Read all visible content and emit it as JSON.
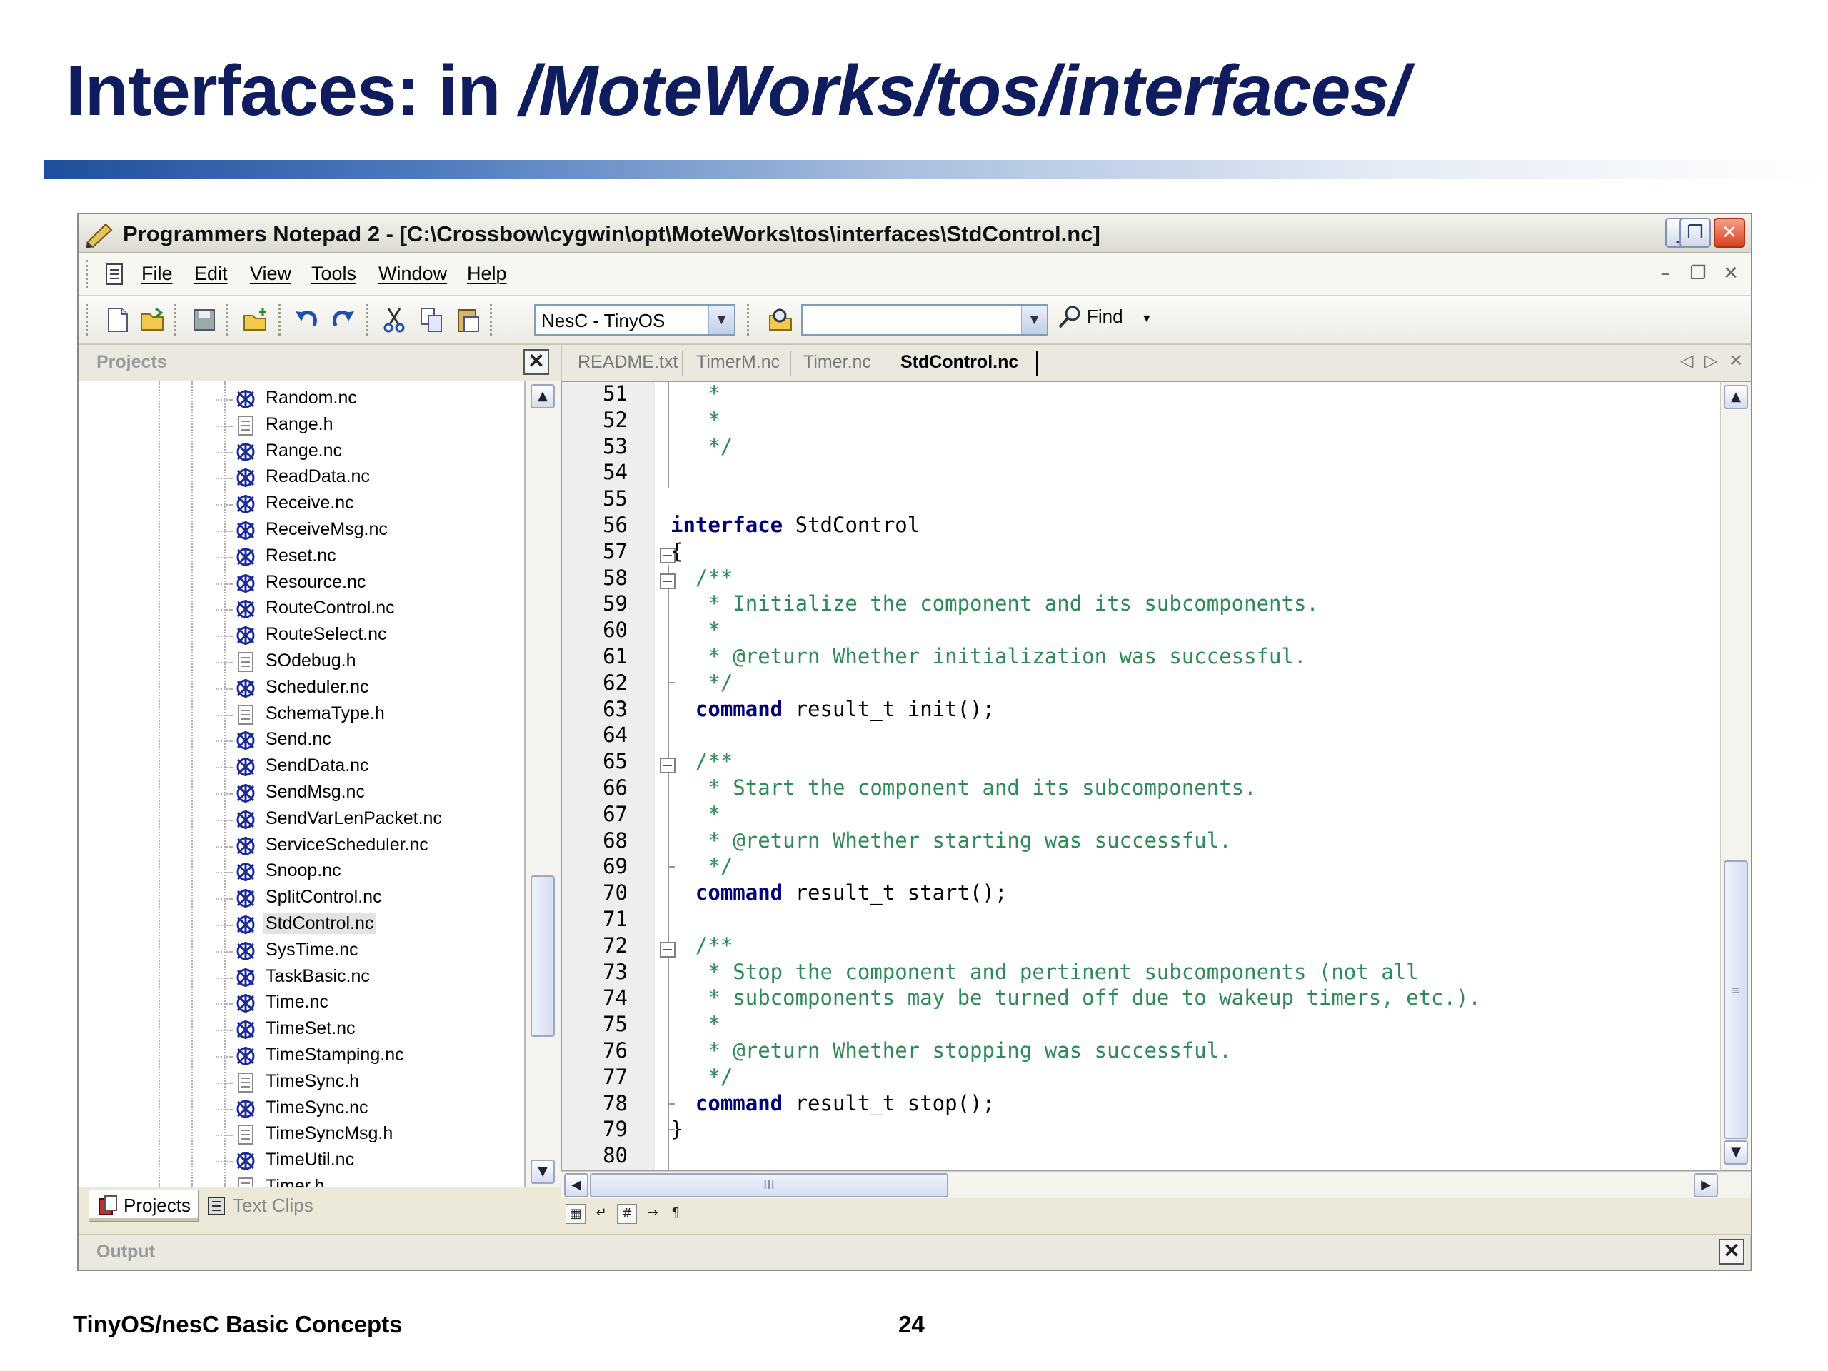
{
  "slide": {
    "title_prefix": "Interfaces: in ",
    "title_path": "/MoteWorks/tos/interfaces/",
    "footer_left": "TinyOS/nesC Basic Concepts",
    "page_number": "24"
  },
  "window": {
    "title": "Programmers Notepad 2 - [C:\\Crossbow\\cygwin\\opt\\MoteWorks\\tos\\interfaces\\StdControl.nc]",
    "minimize": "_",
    "restore": "❐",
    "close": "✕"
  },
  "menu": {
    "items": [
      "File",
      "Edit",
      "View",
      "Tools",
      "Window",
      "Help"
    ],
    "mdi_min": "–",
    "mdi_restore": "❐",
    "mdi_close": "✕"
  },
  "toolbar": {
    "scheme_value": "NesC - TinyOS",
    "search_value": "",
    "find_label": "Find",
    "dropdown_glyph": "▼",
    "combo_arrow": "▼"
  },
  "projects_pane": {
    "header": "Projects",
    "close": "✕",
    "items": [
      {
        "name": "Random.nc",
        "kind": "nc"
      },
      {
        "name": "Range.h",
        "kind": "h"
      },
      {
        "name": "Range.nc",
        "kind": "nc"
      },
      {
        "name": "ReadData.nc",
        "kind": "nc"
      },
      {
        "name": "Receive.nc",
        "kind": "nc"
      },
      {
        "name": "ReceiveMsg.nc",
        "kind": "nc"
      },
      {
        "name": "Reset.nc",
        "kind": "nc"
      },
      {
        "name": "Resource.nc",
        "kind": "nc"
      },
      {
        "name": "RouteControl.nc",
        "kind": "nc"
      },
      {
        "name": "RouteSelect.nc",
        "kind": "nc"
      },
      {
        "name": "SOdebug.h",
        "kind": "h"
      },
      {
        "name": "Scheduler.nc",
        "kind": "nc"
      },
      {
        "name": "SchemaType.h",
        "kind": "h"
      },
      {
        "name": "Send.nc",
        "kind": "nc"
      },
      {
        "name": "SendData.nc",
        "kind": "nc"
      },
      {
        "name": "SendMsg.nc",
        "kind": "nc"
      },
      {
        "name": "SendVarLenPacket.nc",
        "kind": "nc"
      },
      {
        "name": "ServiceScheduler.nc",
        "kind": "nc"
      },
      {
        "name": "Snoop.nc",
        "kind": "nc"
      },
      {
        "name": "SplitControl.nc",
        "kind": "nc"
      },
      {
        "name": "StdControl.nc",
        "kind": "nc",
        "selected": true
      },
      {
        "name": "SysTime.nc",
        "kind": "nc"
      },
      {
        "name": "TaskBasic.nc",
        "kind": "nc"
      },
      {
        "name": "Time.nc",
        "kind": "nc"
      },
      {
        "name": "TimeSet.nc",
        "kind": "nc"
      },
      {
        "name": "TimeStamping.nc",
        "kind": "nc"
      },
      {
        "name": "TimeSync.h",
        "kind": "h"
      },
      {
        "name": "TimeSync.nc",
        "kind": "nc"
      },
      {
        "name": "TimeSyncMsg.h",
        "kind": "h"
      },
      {
        "name": "TimeUtil.nc",
        "kind": "nc"
      },
      {
        "name": "Timer.h",
        "kind": "h"
      }
    ],
    "tabs": [
      "Projects",
      "Text Clips"
    ]
  },
  "editor": {
    "tabs": [
      {
        "label": "README.txt",
        "active": false
      },
      {
        "label": "TimerM.nc",
        "active": false
      },
      {
        "label": "Timer.nc",
        "active": false
      },
      {
        "label": "StdControl.nc",
        "active": true
      }
    ],
    "lines": [
      {
        "n": "51",
        "parts": [
          [
            "c",
            "   *"
          ]
        ]
      },
      {
        "n": "52",
        "parts": [
          [
            "c",
            "   *"
          ]
        ]
      },
      {
        "n": "53",
        "parts": [
          [
            "c",
            "   */"
          ]
        ]
      },
      {
        "n": "54",
        "parts": []
      },
      {
        "n": "55",
        "parts": []
      },
      {
        "n": "56",
        "parts": [
          [
            "k",
            "interface"
          ],
          [
            "p",
            " StdControl"
          ]
        ]
      },
      {
        "n": "57",
        "parts": [
          [
            "p",
            "{"
          ]
        ]
      },
      {
        "n": "58",
        "parts": [
          [
            "c",
            "  /**"
          ]
        ]
      },
      {
        "n": "59",
        "parts": [
          [
            "c",
            "   * Initialize the component and its subcomponents."
          ]
        ]
      },
      {
        "n": "60",
        "parts": [
          [
            "c",
            "   *"
          ]
        ]
      },
      {
        "n": "61",
        "parts": [
          [
            "c",
            "   * @return Whether initialization was successful."
          ]
        ]
      },
      {
        "n": "62",
        "parts": [
          [
            "c",
            "   */"
          ]
        ]
      },
      {
        "n": "63",
        "parts": [
          [
            "p",
            "  "
          ],
          [
            "k",
            "command"
          ],
          [
            "p",
            " result_t init();"
          ]
        ]
      },
      {
        "n": "64",
        "parts": []
      },
      {
        "n": "65",
        "parts": [
          [
            "c",
            "  /**"
          ]
        ]
      },
      {
        "n": "66",
        "parts": [
          [
            "c",
            "   * Start the component and its subcomponents."
          ]
        ]
      },
      {
        "n": "67",
        "parts": [
          [
            "c",
            "   *"
          ]
        ]
      },
      {
        "n": "68",
        "parts": [
          [
            "c",
            "   * @return Whether starting was successful."
          ]
        ]
      },
      {
        "n": "69",
        "parts": [
          [
            "c",
            "   */"
          ]
        ]
      },
      {
        "n": "70",
        "parts": [
          [
            "p",
            "  "
          ],
          [
            "k",
            "command"
          ],
          [
            "p",
            " result_t start();"
          ]
        ]
      },
      {
        "n": "71",
        "parts": []
      },
      {
        "n": "72",
        "parts": [
          [
            "c",
            "  /**"
          ]
        ]
      },
      {
        "n": "73",
        "parts": [
          [
            "c",
            "   * Stop the component and pertinent subcomponents (not all"
          ]
        ]
      },
      {
        "n": "74",
        "parts": [
          [
            "c",
            "   * subcomponents may be turned off due to wakeup timers, etc.)."
          ]
        ]
      },
      {
        "n": "75",
        "parts": [
          [
            "c",
            "   *"
          ]
        ]
      },
      {
        "n": "76",
        "parts": [
          [
            "c",
            "   * @return Whether stopping was successful."
          ]
        ]
      },
      {
        "n": "77",
        "parts": [
          [
            "c",
            "   */"
          ]
        ]
      },
      {
        "n": "78",
        "parts": [
          [
            "p",
            "  "
          ],
          [
            "k",
            "command"
          ],
          [
            "p",
            " result_t stop();"
          ]
        ]
      },
      {
        "n": "79",
        "parts": [
          [
            "p",
            "}"
          ]
        ]
      },
      {
        "n": "80",
        "parts": []
      }
    ],
    "hscroll_grip": "III",
    "vscroll_grip": "≡"
  },
  "output_pane": {
    "header": "Output",
    "close": "✕"
  },
  "colors": {
    "title_blue": "#0f1c5e",
    "keyword": "#00007a",
    "comment": "#2e8b57",
    "nc_icon": "#1a2a9a",
    "h_icon": "#8a8a8a"
  }
}
